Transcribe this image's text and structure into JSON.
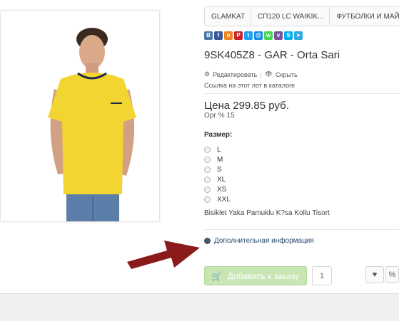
{
  "breadcrumb": [
    "GLAMKAT",
    "СП120 LC WAIKIK...",
    "ФУТБОЛКИ И МАЙК..."
  ],
  "share": {
    "buttons": [
      {
        "name": "vk-icon",
        "glyph": "В",
        "color": "#4a76a8"
      },
      {
        "name": "facebook-icon",
        "glyph": "f",
        "color": "#3b5998"
      },
      {
        "name": "odnoklassniki-icon",
        "glyph": "о",
        "color": "#f58220"
      },
      {
        "name": "pinterest-icon",
        "glyph": "P",
        "color": "#cb2027"
      },
      {
        "name": "twitter-icon",
        "glyph": "t",
        "color": "#1da1f2"
      },
      {
        "name": "mailru-icon",
        "glyph": "@",
        "color": "#168de2"
      },
      {
        "name": "whatsapp-icon",
        "glyph": "w",
        "color": "#43d854"
      },
      {
        "name": "viber-icon",
        "glyph": "v",
        "color": "#7b519d"
      },
      {
        "name": "skype-icon",
        "glyph": "S",
        "color": "#00aff0"
      },
      {
        "name": "telegram-icon",
        "glyph": "➤",
        "color": "#2fa8e0"
      }
    ]
  },
  "product": {
    "title": "9SK405Z8 - GAR - Orta Sari",
    "edit_label": "Редактировать",
    "hide_label": "Скрыть",
    "catalog_link": "Ссылка на этот лот в каталоге",
    "price": "Цена 299.85 руб.",
    "org": "Орг % 15",
    "size_label": "Размер:",
    "sizes": [
      "L",
      "M",
      "S",
      "XL",
      "XS",
      "XXL"
    ],
    "description": "Bisiklet Yaka Pamuklu K?sa Kollu Tisort",
    "more_info": "Дополнительная информация"
  },
  "actions": {
    "add_label": "Добавить к заказу",
    "quantity": "1"
  },
  "colors": {
    "shirt": "#f2d531",
    "arrow": "#8b1a1a",
    "add_button": "#c8e6b4"
  }
}
